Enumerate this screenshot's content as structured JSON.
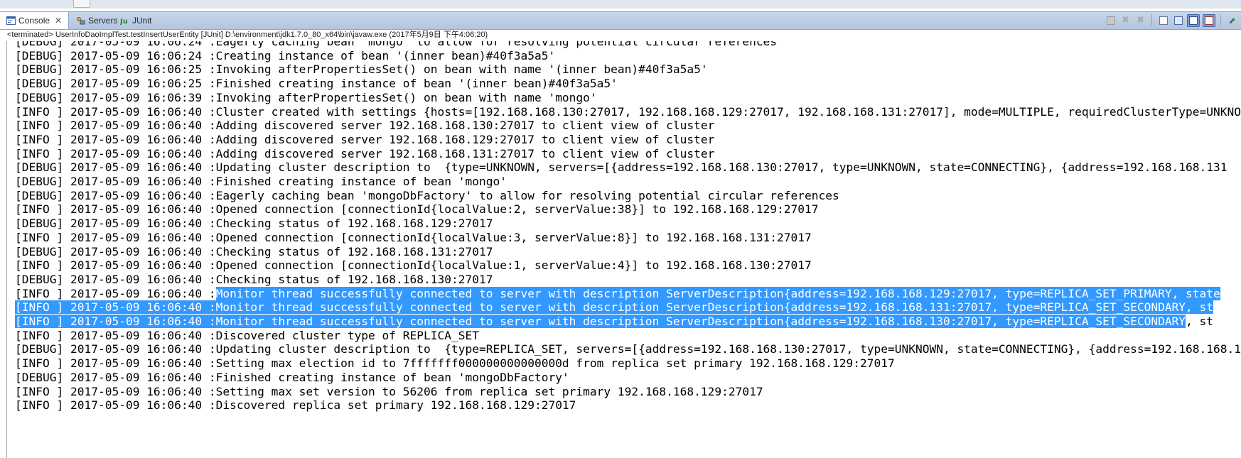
{
  "tabs": [
    {
      "label": "Console",
      "icon": "console-icon",
      "active": true
    },
    {
      "label": "Servers",
      "icon": "servers-icon",
      "active": false
    },
    {
      "label": "JUnit",
      "icon": "junit-icon",
      "active": false
    }
  ],
  "toolbar": {
    "icons": [
      "terminate-icon",
      "remove-launch-icon",
      "remove-all-terminated-icon",
      "clear-console-icon",
      "scroll-lock-icon",
      "show-on-stdout-icon",
      "show-on-stderr-icon",
      "pin-console-icon"
    ]
  },
  "status": "<terminated> UserInfoDaoImplTest.testInsertUserEntity [JUnit] D:\\environment\\jdk1.7.0_80_x64\\bin\\javaw.exe (2017年5月9日 下午4:06:20)",
  "log": [
    {
      "level": "[DEBUG]",
      "time": "2017-05-09 16:06:24",
      "message": ":Eagerly caching bean 'mongo' to allow for resolving potential circular references"
    },
    {
      "level": "[DEBUG]",
      "time": "2017-05-09 16:06:24",
      "message": ":Creating instance of bean '(inner bean)#40f3a5a5'"
    },
    {
      "level": "[DEBUG]",
      "time": "2017-05-09 16:06:25",
      "message": ":Invoking afterPropertiesSet() on bean with name '(inner bean)#40f3a5a5'"
    },
    {
      "level": "[DEBUG]",
      "time": "2017-05-09 16:06:25",
      "message": ":Finished creating instance of bean '(inner bean)#40f3a5a5'"
    },
    {
      "level": "[DEBUG]",
      "time": "2017-05-09 16:06:39",
      "message": ":Invoking afterPropertiesSet() on bean with name 'mongo'"
    },
    {
      "level": "[INFO ]",
      "time": "2017-05-09 16:06:40",
      "message": ":Cluster created with settings {hosts=[192.168.168.130:27017, 192.168.168.129:27017, 192.168.168.131:27017], mode=MULTIPLE, requiredClusterType=UNKNOWN"
    },
    {
      "level": "[INFO ]",
      "time": "2017-05-09 16:06:40",
      "message": ":Adding discovered server 192.168.168.130:27017 to client view of cluster"
    },
    {
      "level": "[INFO ]",
      "time": "2017-05-09 16:06:40",
      "message": ":Adding discovered server 192.168.168.129:27017 to client view of cluster"
    },
    {
      "level": "[INFO ]",
      "time": "2017-05-09 16:06:40",
      "message": ":Adding discovered server 192.168.168.131:27017 to client view of cluster"
    },
    {
      "level": "[DEBUG]",
      "time": "2017-05-09 16:06:40",
      "message": ":Updating cluster description to  {type=UNKNOWN, servers=[{address=192.168.168.130:27017, type=UNKNOWN, state=CONNECTING}, {address=192.168.168.131"
    },
    {
      "level": "[DEBUG]",
      "time": "2017-05-09 16:06:40",
      "message": ":Finished creating instance of bean 'mongo'"
    },
    {
      "level": "[DEBUG]",
      "time": "2017-05-09 16:06:40",
      "message": ":Eagerly caching bean 'mongoDbFactory' to allow for resolving potential circular references"
    },
    {
      "level": "[INFO ]",
      "time": "2017-05-09 16:06:40",
      "message": ":Opened connection [connectionId{localValue:2, serverValue:38}] to 192.168.168.129:27017"
    },
    {
      "level": "[DEBUG]",
      "time": "2017-05-09 16:06:40",
      "message": ":Checking status of 192.168.168.129:27017"
    },
    {
      "level": "[INFO ]",
      "time": "2017-05-09 16:06:40",
      "message": ":Opened connection [connectionId{localValue:3, serverValue:8}] to 192.168.168.131:27017"
    },
    {
      "level": "[DEBUG]",
      "time": "2017-05-09 16:06:40",
      "message": ":Checking status of 192.168.168.131:27017"
    },
    {
      "level": "[INFO ]",
      "time": "2017-05-09 16:06:40",
      "message": ":Opened connection [connectionId{localValue:1, serverValue:4}] to 192.168.168.130:27017"
    },
    {
      "level": "[DEBUG]",
      "time": "2017-05-09 16:06:40",
      "message": ":Checking status of 192.168.168.130:27017"
    },
    {
      "level": "[INFO ]",
      "time": "2017-05-09 16:06:40",
      "message": ":Monitor thread successfully connected to server with description ServerDescription{address=192.168.168.129:27017, type=REPLICA_SET_PRIMARY, state",
      "selected": "message"
    },
    {
      "level": "[INFO ]",
      "time": "2017-05-09 16:06:40",
      "message": ":Monitor thread successfully connected to server with description ServerDescription{address=192.168.168.131:27017, type=REPLICA_SET_SECONDARY, st",
      "selected": "all"
    },
    {
      "level": "[INFO ]",
      "time": "2017-05-09 16:06:40",
      "message": ":Monitor thread successfully connected to server with description ServerDescription{address=192.168.168.130:27017, type=REPLICA_SET_SECONDARY",
      "tail": ", st",
      "selected": "all"
    },
    {
      "level": "[INFO ]",
      "time": "2017-05-09 16:06:40",
      "message": ":Discovered cluster type of REPLICA_SET"
    },
    {
      "level": "[DEBUG]",
      "time": "2017-05-09 16:06:40",
      "message": ":Updating cluster description to  {type=REPLICA_SET, servers=[{address=192.168.168.130:27017, type=UNKNOWN, state=CONNECTING}, {address=192.168.168.1"
    },
    {
      "level": "[INFO ]",
      "time": "2017-05-09 16:06:40",
      "message": ":Setting max election id to 7fffffff000000000000000d from replica set primary 192.168.168.129:27017"
    },
    {
      "level": "[DEBUG]",
      "time": "2017-05-09 16:06:40",
      "message": ":Finished creating instance of bean 'mongoDbFactory'"
    },
    {
      "level": "[INFO ]",
      "time": "2017-05-09 16:06:40",
      "message": ":Setting max set version to 56206 from replica set primary 192.168.168.129:27017"
    },
    {
      "level": "[INFO ]",
      "time": "2017-05-09 16:06:40",
      "message": ":Discovered replica set primary 192.168.168.129:27017"
    }
  ]
}
